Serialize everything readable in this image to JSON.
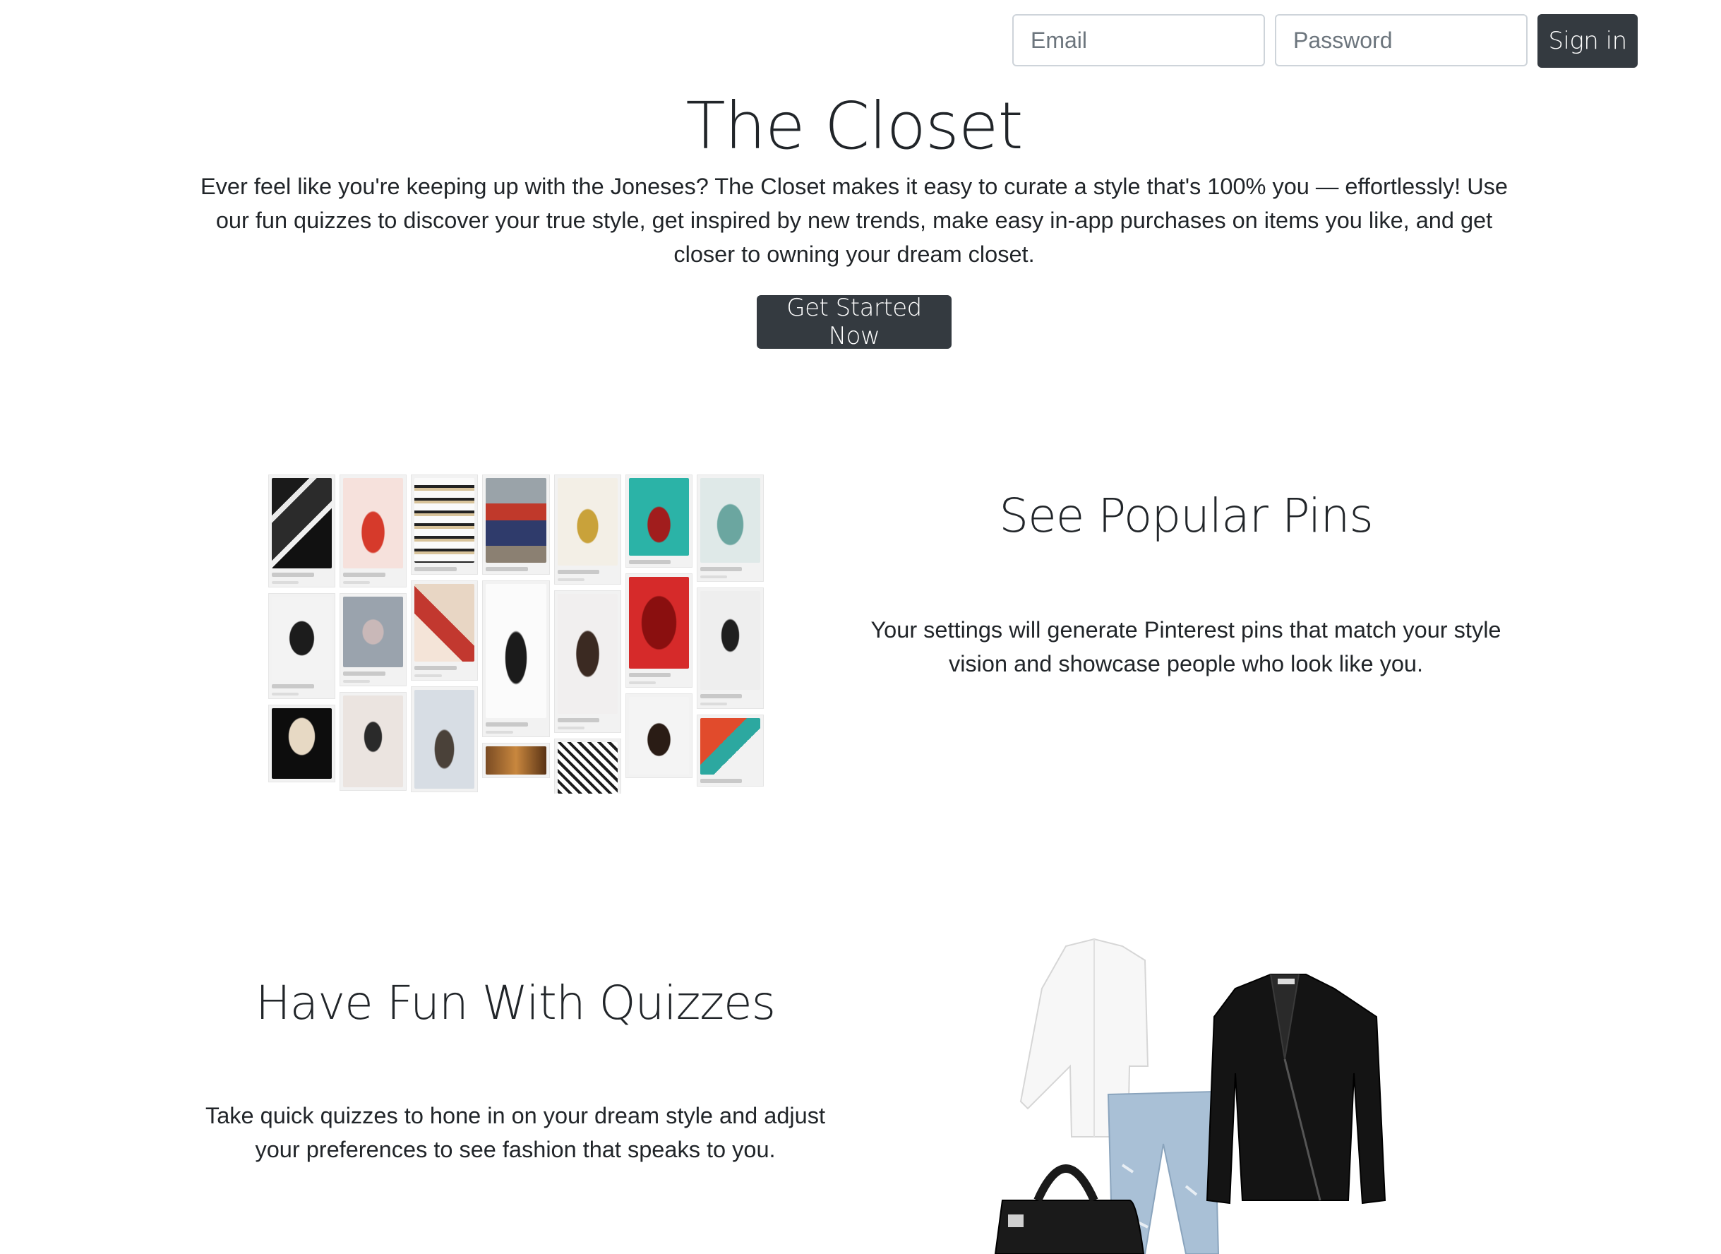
{
  "signin": {
    "email_placeholder": "Email",
    "password_placeholder": "Password",
    "button_label": "Sign in"
  },
  "hero": {
    "title": "The Closet",
    "description": "Ever feel like you're keeping up with the Joneses? The Closet makes it easy to curate a style that's 100% you — effortlessly! Use our fun quizzes to discover your true style, get inspired by new trends, make easy in-app purchases on items you like, and get closer to owning your dream closet.",
    "cta_label": "Get Started Now"
  },
  "pins_section": {
    "heading": "See Popular Pins",
    "text": "Your settings will generate Pinterest pins that match your style vision and showcase people who look like you."
  },
  "quizzes_section": {
    "heading": "Have Fun With Quizzes",
    "text": "Take quick quizzes to hone in on your dream style and adjust your preferences to see fashion that speaks to you."
  },
  "colors": {
    "button_bg": "#343a40",
    "text": "#212529",
    "input_border": "#ced4da"
  }
}
